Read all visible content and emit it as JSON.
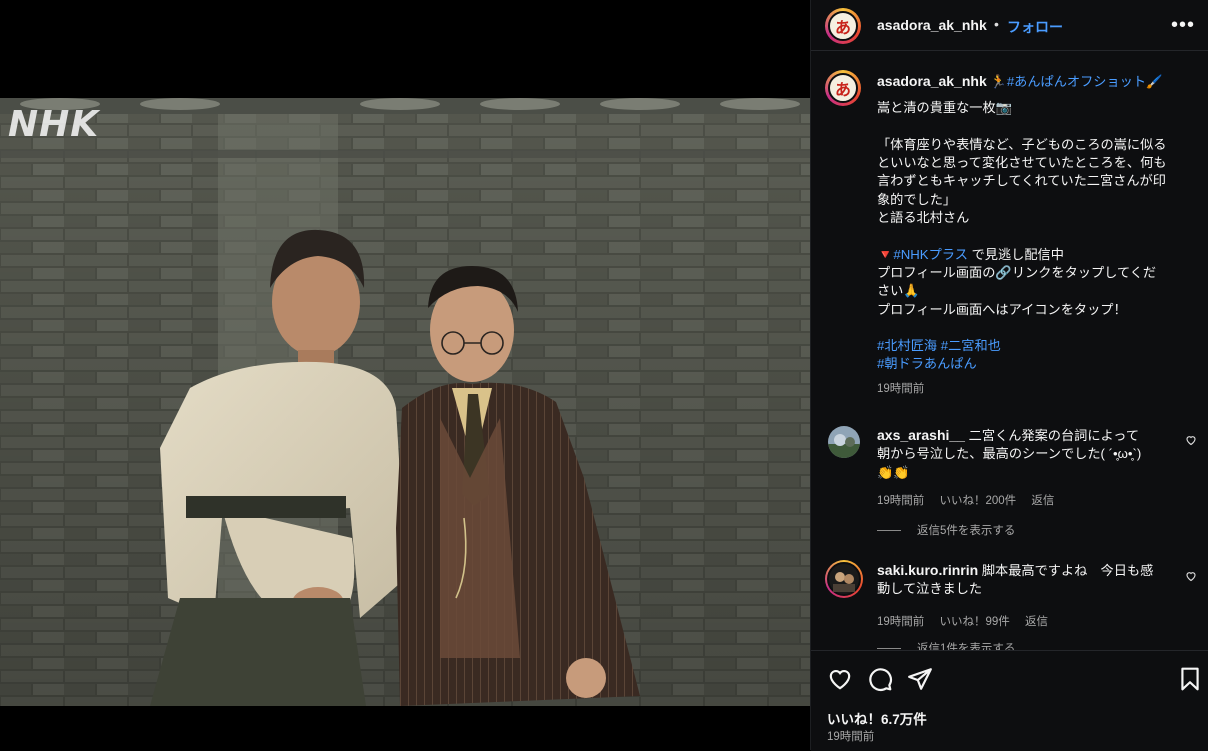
{
  "post": {
    "logo_text": "NHK"
  },
  "header": {
    "username": "asadora_ak_nhk",
    "separator": "•",
    "follow_label": "フォロー",
    "more_label": "•••",
    "avatar_glyph": "あ"
  },
  "caption": {
    "username": "asadora_ak_nhk",
    "runner_emoji": "🏃",
    "hashtag_main": "#あんぱんオフショット",
    "pencil_emoji": "🖌️",
    "line1": "嵩と清の貴重な一枚📷",
    "line2": "「体育座りや表情など、子どものころの嵩に似る",
    "line3": "といいなと思って変化させていたところを、何も",
    "line4": "言わずともキャッチしてくれていた二宮さんが印",
    "line5": "象的でした」",
    "line6": "と語る北村さん",
    "arrow_emoji": "🔻",
    "hashtag_plus": "#NHKプラス",
    "line7_rest": " で見逃し配信中",
    "line8": "プロフィール画面の🔗リンクをタップしてくだ",
    "line9": "さい🙏",
    "line10": "プロフィール画面へはアイコンをタップ！",
    "tag1": "#北村匠海",
    "tag2": "#二宮和也",
    "tag3": "#朝ドラあんぱん",
    "time": "19時間前"
  },
  "comments": [
    {
      "username": "axs_arashi__",
      "text1": " 二宮くん発案の台詞によって",
      "text2": "朝から号泣した、最高のシーンでした( ´•̥ω•̥`)",
      "text3": "👏👏",
      "time": "19時間前",
      "likes": "いいね！200件",
      "reply": "返信",
      "view_replies": "返信5件を表示する"
    },
    {
      "username": "saki.kuro.rinrin",
      "text1": " 脚本最高ですよね　今日も感",
      "text2": "動して泣きました",
      "time": "19時間前",
      "likes": "いいね！99件",
      "reply": "返信",
      "view_replies": "返信1件を表示する"
    }
  ],
  "footer": {
    "likes": "いいね！6.7万件",
    "time": "19時間前"
  },
  "icons": {
    "like": "heart-icon",
    "comment": "comment-icon",
    "share": "paper-plane-icon",
    "save": "bookmark-icon",
    "more": "more-horizontal-icon"
  },
  "colors": {
    "panel_bg": "#0d0e10",
    "link_blue": "#4a9cff",
    "muted_text": "#a8a8a8"
  }
}
